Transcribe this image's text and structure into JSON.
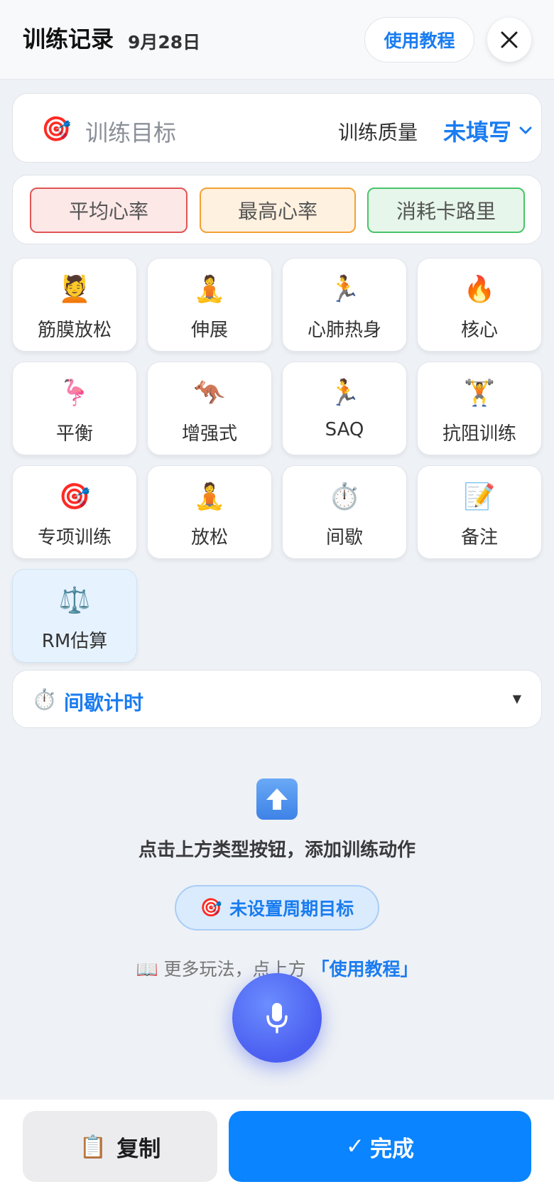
{
  "header": {
    "title": "训练记录",
    "date": "9月28日",
    "tutorial_label": "使用教程",
    "close_icon": "close-icon"
  },
  "goal": {
    "icon": "🎯",
    "placeholder": "训练目标",
    "quality_label": "训练质量",
    "quality_value": "未填写"
  },
  "metrics": [
    {
      "label": "平均心率",
      "color": "#e05454"
    },
    {
      "label": "最高心率",
      "color": "#f2a134"
    },
    {
      "label": "消耗卡路里",
      "color": "#48c46a"
    }
  ],
  "categories": [
    {
      "emoji": "💆",
      "label": "筋膜放松"
    },
    {
      "emoji": "🧘",
      "label": "伸展"
    },
    {
      "emoji": "🏃",
      "label": "心肺热身"
    },
    {
      "emoji": "🔥",
      "label": "核心"
    },
    {
      "emoji": "🦩",
      "label": "平衡"
    },
    {
      "emoji": "🦘",
      "label": "增强式"
    },
    {
      "emoji": "🏃",
      "label": "SAQ"
    },
    {
      "emoji": "🏋️",
      "label": "抗阻训练"
    },
    {
      "emoji": "🎯",
      "label": "专项训练"
    },
    {
      "emoji": "🧘",
      "label": "放松"
    },
    {
      "emoji": "⏱️",
      "label": "间歇"
    },
    {
      "emoji": "📝",
      "label": "备注"
    },
    {
      "emoji": "⚖️",
      "label": "RM估算"
    }
  ],
  "interval": {
    "icon": "⏱️",
    "label": "间歇计时",
    "caret": "▼"
  },
  "empty_state": {
    "hint": "点击上方类型按钮，添加训练动作",
    "cycle_icon": "🎯",
    "cycle_label": "未设置周期目标",
    "more_icon": "📖",
    "more_text": "更多玩法，点上方",
    "more_link": "「使用教程」"
  },
  "bottom": {
    "copy_icon": "📋",
    "copy_label": "复制",
    "done_check": "✓",
    "done_label": "完成"
  },
  "colors": {
    "accent": "#1a7cf0",
    "done": "#0a84ff",
    "mic": "#4a5ef0"
  }
}
